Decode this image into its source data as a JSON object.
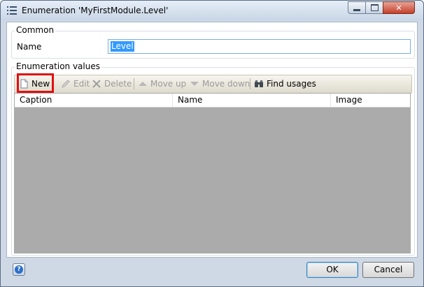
{
  "window": {
    "title": "Enumeration 'MyFirstModule.Level'"
  },
  "common": {
    "group_label": "Common",
    "name_label": "Name",
    "name_value": "Level"
  },
  "enum_values": {
    "group_label": "Enumeration values",
    "toolbar": {
      "new": "New",
      "edit": "Edit",
      "delete": "Delete",
      "move_up": "Move up",
      "move_down": "Move down",
      "find_usages": "Find usages"
    },
    "columns": [
      "Caption",
      "Name",
      "Image"
    ],
    "rows": []
  },
  "footer": {
    "ok": "OK",
    "cancel": "Cancel",
    "help_glyph": "?"
  },
  "colors": {
    "highlight": "#e01010",
    "selection": "#3399ff",
    "grid_empty": "#ababab"
  },
  "icons": [
    "list-icon",
    "new-document-icon",
    "edit-pencil-icon",
    "delete-x-icon",
    "arrow-up-icon",
    "arrow-down-icon",
    "binoculars-icon",
    "help-icon"
  ]
}
